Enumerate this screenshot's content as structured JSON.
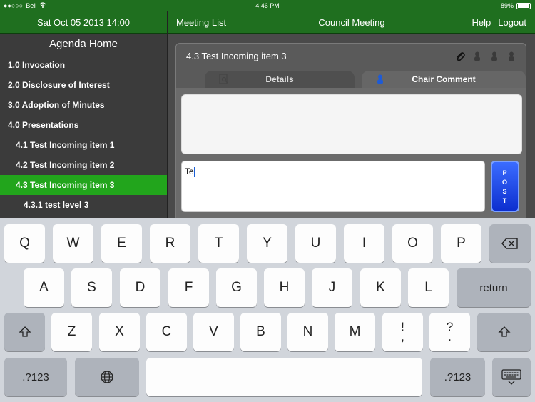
{
  "status": {
    "carrier": "Bell",
    "time": "4:46 PM",
    "battery": "89%"
  },
  "left": {
    "date": "Sat Oct 05 2013 14:00",
    "title": "Agenda Home",
    "items": [
      {
        "label": "1.0 Invocation",
        "level": 1
      },
      {
        "label": "2.0 Disclosure of Interest",
        "level": 1
      },
      {
        "label": "3.0 Adoption of Minutes",
        "level": 1
      },
      {
        "label": "4.0 Presentations",
        "level": 1
      },
      {
        "label": "4.1 Test Incoming item 1",
        "level": 2
      },
      {
        "label": "4.2 Test Incoming item 2",
        "level": 2
      },
      {
        "label": "4.3 Test Incoming item 3",
        "level": 2,
        "selected": true
      },
      {
        "label": "4.3.1 test level 3",
        "level": 3
      }
    ]
  },
  "header": {
    "meeting_list": "Meeting List",
    "title": "Council Meeting",
    "help": "Help",
    "logout": "Logout"
  },
  "card": {
    "title": "4.3 Test Incoming item 3",
    "tabs": {
      "details": "Details",
      "chair_comment": "Chair Comment"
    },
    "input_value": "Te",
    "post_letters": [
      "P",
      "O",
      "S",
      "T"
    ]
  },
  "keyboard": {
    "row1": [
      "Q",
      "W",
      "E",
      "R",
      "T",
      "Y",
      "U",
      "I",
      "O",
      "P"
    ],
    "row2": [
      "A",
      "S",
      "D",
      "F",
      "G",
      "H",
      "J",
      "K",
      "L"
    ],
    "row3": [
      "Z",
      "X",
      "C",
      "V",
      "B",
      "N",
      "M"
    ],
    "return": "return",
    "numbers": ".?123",
    "punct1": [
      "!",
      ","
    ],
    "punct2": [
      "?",
      "."
    ]
  },
  "colors": {
    "green_bar": "#1f6f1f",
    "selected": "#22a51c",
    "post": "#1e43e6"
  }
}
